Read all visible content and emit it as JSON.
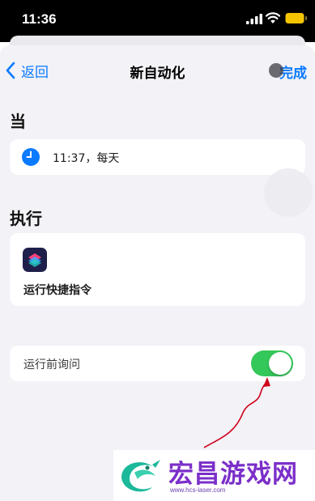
{
  "status_bar": {
    "time": "11:36",
    "signal_icon": "cellular-signal-icon",
    "wifi_icon": "wifi-icon",
    "battery_icon": "battery-icon",
    "battery_color": "#f5c400"
  },
  "nav": {
    "back_label": "返回",
    "title": "新自动化",
    "done_label": "完成"
  },
  "when_section": {
    "heading": "当",
    "trigger_text": "11:37，每天",
    "icon": "clock-icon"
  },
  "do_section": {
    "heading": "执行",
    "action_label": "运行快捷指令",
    "icon": "shortcuts-app-icon"
  },
  "ask_before_running": {
    "label": "运行前询问",
    "enabled": true
  },
  "colors": {
    "accent": "#0a7aff",
    "toggle_on": "#34c759",
    "background": "#f2f2f7",
    "annotation_arrow": "#d0021b"
  },
  "watermark": {
    "title": "宏昌游戏网",
    "url": "www.hcs-laser.com"
  }
}
